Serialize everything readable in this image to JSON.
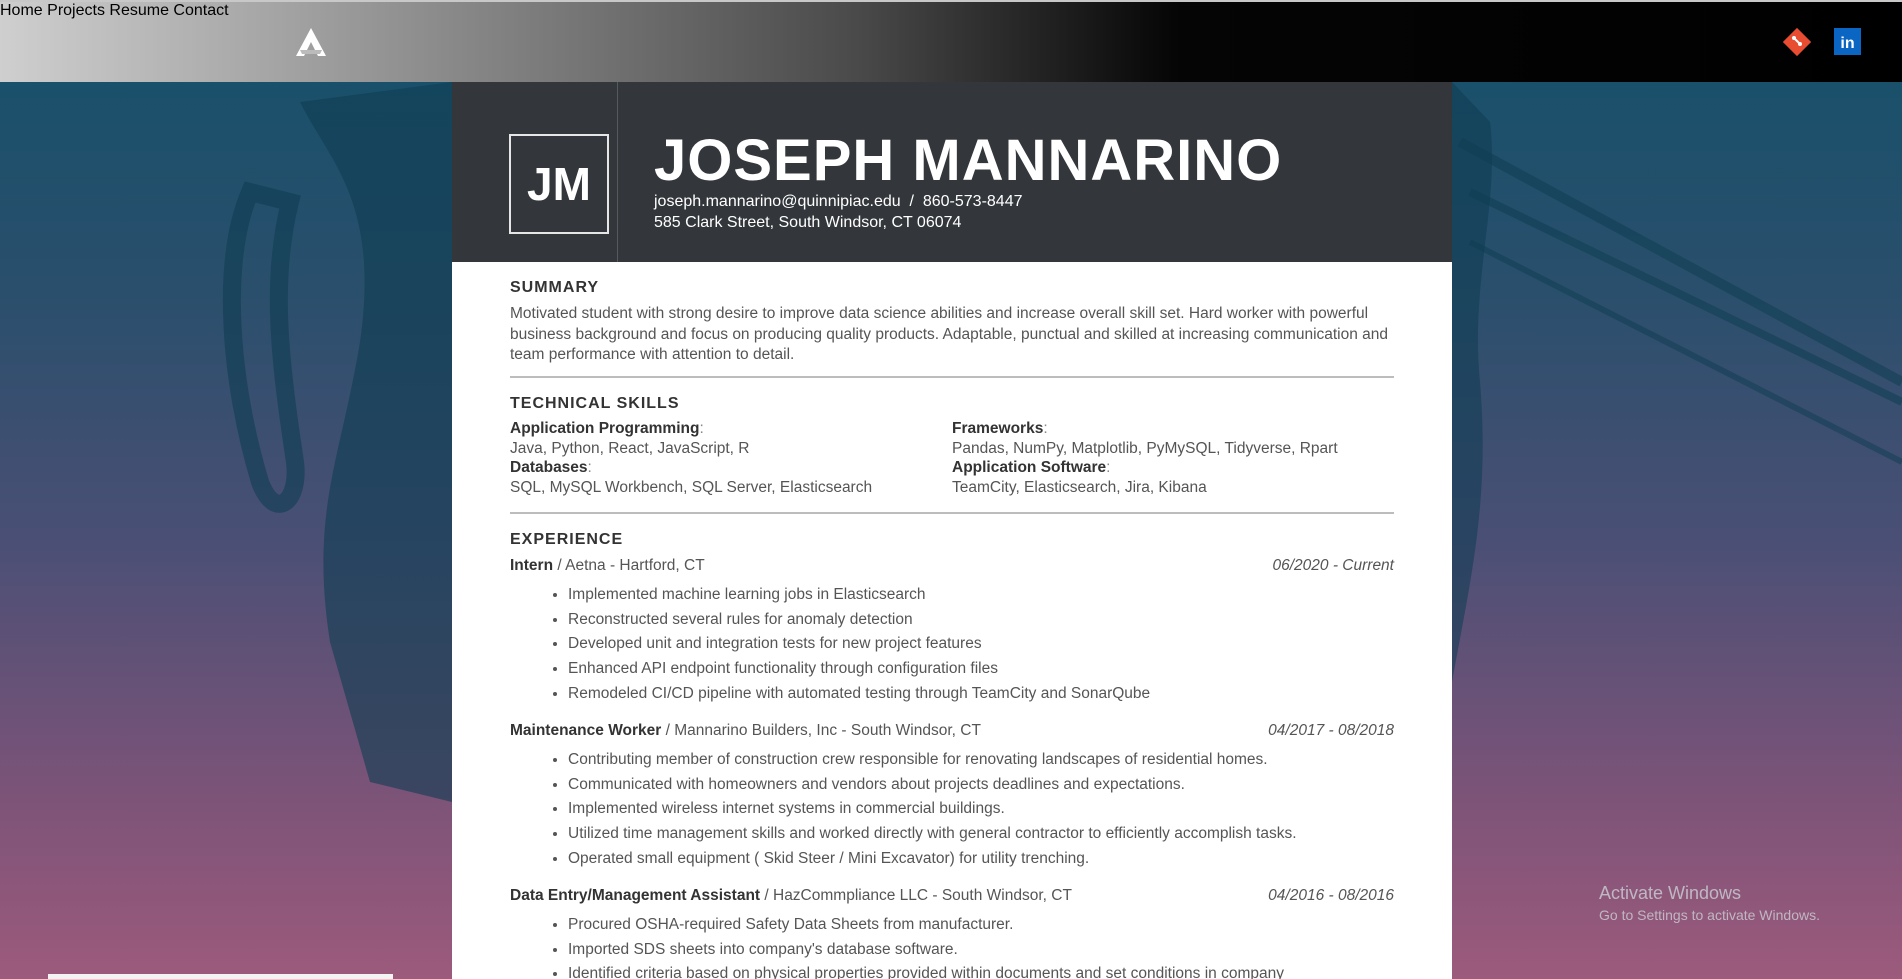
{
  "nav": {
    "items": [
      "Home",
      "Projects",
      "Resume",
      "Contact"
    ]
  },
  "social": {
    "git_icon": "git-icon",
    "linkedin_label": "in"
  },
  "resume": {
    "initials": "JM",
    "name": "JOSEPH MANNARINO",
    "contact_line1": "joseph.mannarino@quinnipiac.edu  /  860-573-8447",
    "contact_line2": "585 Clark Street, South Windsor, CT 06074",
    "summary_title": "SUMMARY",
    "summary": "Motivated student with strong desire to improve data science abilities and increase overall skill set. Hard worker with powerful business background and focus on producing quality products. Adaptable, punctual and skilled at increasing communication and team performance with attention to detail.",
    "skills_title": "TECHNICAL SKILLS",
    "skills": [
      {
        "label": "Application Programming",
        "value": "Java, Python, React, JavaScript, R"
      },
      {
        "label": "Frameworks",
        "value": "Pandas, NumPy, Matplotlib, PyMySQL, Tidyverse, Rpart"
      },
      {
        "label": "Databases",
        "value": "SQL, MySQL Workbench, SQL Server, Elasticsearch"
      },
      {
        "label": "Application Software",
        "value": "TeamCity, Elasticsearch, Jira, Kibana"
      }
    ],
    "experience_title": "EXPERIENCE",
    "jobs": [
      {
        "title": "Intern",
        "org": " / Aetna - Hartford, CT",
        "dates": "06/2020 - Current",
        "bullets": [
          "Implemented machine learning jobs in Elasticsearch",
          "Reconstructed several rules for anomaly detection",
          "Developed unit and integration tests for new project features",
          "Enhanced API endpoint functionality through configuration files",
          "Remodeled CI/CD pipeline with automated testing through TeamCity and SonarQube"
        ]
      },
      {
        "title": "Maintenance Worker",
        "org": " / Mannarino Builders, Inc - South Windsor, CT",
        "dates": "04/2017 - 08/2018",
        "bullets": [
          "Contributing member of construction crew responsible for renovating landscapes of residential homes.",
          "Communicated with homeowners and vendors about projects deadlines and expectations.",
          "Implemented wireless internet systems in commercial buildings.",
          "Utilized time management skills and worked directly with general contractor to efficiently accomplish tasks.",
          "Operated small equipment ( Skid Steer / Mini Excavator) for utility trenching."
        ]
      },
      {
        "title": "Data Entry/Management Assistant",
        "org": " / HazCommpliance LLC - South Windsor, CT",
        "dates": "04/2016 - 08/2016",
        "bullets": [
          "Procured OSHA-required Safety Data Sheets from manufacturer.",
          "Imported SDS sheets into company's database software.",
          "Identified criteria based on physical properties provided within documents and set conditions in company"
        ]
      }
    ]
  },
  "os_watermark": {
    "line1": "Activate Windows",
    "line2": "Go to Settings to activate Windows."
  }
}
